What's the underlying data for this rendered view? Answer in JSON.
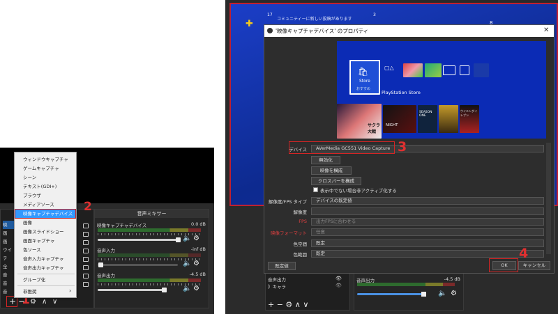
{
  "left": {
    "context_menu": {
      "items": [
        "ウィンドウキャプチャ",
        "ゲームキャプチャ",
        "シーン",
        "テキスト(GDI+)",
        "ブラウザ",
        "メディアソース",
        "映像キャプチャデバイス",
        "画像",
        "画像スライドショー",
        "画面キャプチャ",
        "色ソース",
        "音声入力キャプチャ",
        "音声出力キャプチャ",
        "グループ化",
        "非推奨"
      ],
      "selected_index": 6,
      "submenu_arrow": "›"
    },
    "sources": {
      "items": [
        "映",
        "画",
        "画",
        "ウイ",
        "テ",
        "全",
        "音",
        "音",
        "音",
        "》キ"
      ]
    },
    "mixer": {
      "title": "音声ミキサー",
      "channels": [
        {
          "name": "映像キャプチャデバイス",
          "db": "0.0 dB"
        },
        {
          "name": "音声入力",
          "db": "-inf dB"
        },
        {
          "name": "音声出力",
          "db": "-4.5 dB"
        }
      ]
    },
    "annotations": {
      "step1": "1",
      "step2": "2"
    },
    "toolbar": {
      "add": "+",
      "remove": "−",
      "settings": "⚙",
      "up": "∧",
      "down": "∨"
    }
  },
  "ps_home": {
    "notif_count": "17",
    "notif_text": "コミュニティーに新しい投稿があります",
    "badge_count": "3",
    "trophy_count": "8"
  },
  "dialog": {
    "title": "'映像キャプチャデバイス' のプロパティ",
    "preview": {
      "store_label": "Store",
      "store_sub": "おすすめ",
      "store_caption": "PlayStation Store",
      "game_title": "サクラ大戦",
      "tile2": "NIGHT",
      "tile3": "SEASON ONE",
      "tile4": "ウイニングイレブン"
    },
    "rows": [
      {
        "label": "デバイス",
        "value": "AVerMedia GC551 Video Capture",
        "label_color": "#dddddd"
      },
      {
        "label": "",
        "value": "無効化",
        "button": true
      },
      {
        "label": "",
        "value": "映像を構成",
        "button": true
      },
      {
        "label": "",
        "value": "クロスバーを構成",
        "button": true
      },
      {
        "label": "",
        "value": "表示中でない場合非アクティブ化する",
        "checkbox": true
      },
      {
        "label": "解像度/FPS タイプ",
        "value": "デバイスの既定値",
        "label_color": "#dddddd"
      },
      {
        "label": "解像度",
        "value": "",
        "label_color": "#dddddd"
      },
      {
        "label": "FPS",
        "value": "出力FPSに合わせる",
        "label_color": "#e04040"
      },
      {
        "label": "映像フォーマット",
        "value": "任意",
        "label_color": "#e04040"
      },
      {
        "label": "色空間",
        "value": "既定",
        "label_color": "#dddddd"
      },
      {
        "label": "色範囲",
        "value": "既定",
        "label_color": "#dddddd"
      }
    ],
    "defaults_btn": "既定値",
    "ok_btn": "OK",
    "cancel_btn": "キャンセル",
    "annotations": {
      "step3": "3",
      "step4": "4"
    }
  },
  "right_obs": {
    "sources": [
      "音声出力",
      "》キャラ"
    ],
    "mixer_channel": "音声出力",
    "mixer_db": "-4.5 dB"
  },
  "colors": {
    "accent": "#3399ff",
    "annotation": "#e03030",
    "ps_blue": "#1b3ec7"
  }
}
